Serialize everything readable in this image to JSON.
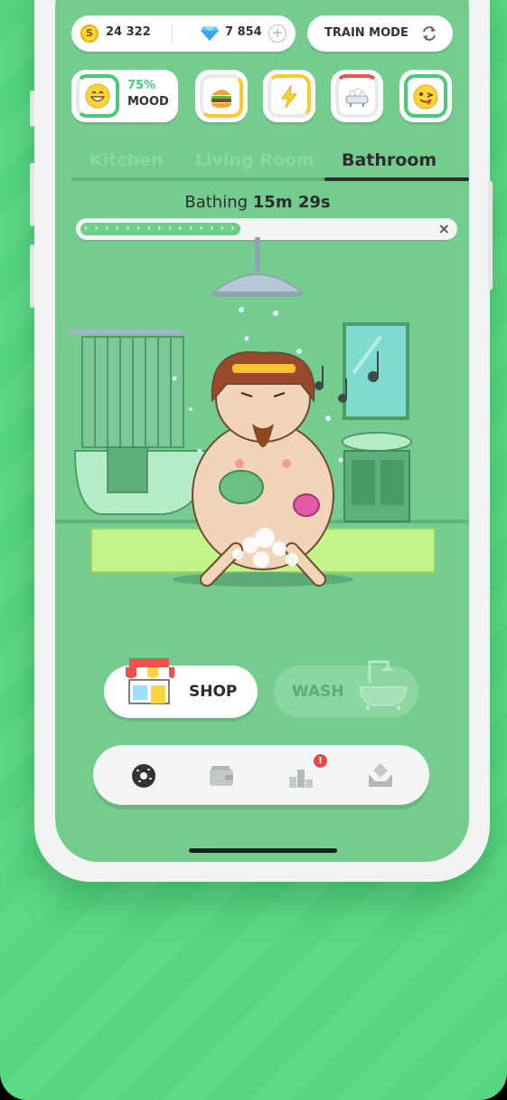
{
  "topbar": {
    "coin_symbol": "S",
    "coins": "24 322",
    "gems": "7 854",
    "add_symbol": "+",
    "train_mode_label": "TRAIN MODE"
  },
  "stats": {
    "mood_percent": "75%",
    "mood_label": "MOOD",
    "items": [
      {
        "icon": "happy-face-icon",
        "level": 0.75,
        "color": "#4cc87a"
      },
      {
        "icon": "burger-icon",
        "level": 0.5,
        "color": "#ffc82c"
      },
      {
        "icon": "lightning-icon",
        "level": 0.35,
        "color": "#ffc82c"
      },
      {
        "icon": "bathtub-icon",
        "level": 0.15,
        "color": "#f2504b"
      },
      {
        "icon": "wink-face-icon",
        "level": 1.0,
        "color": "#4cc87a"
      }
    ]
  },
  "tabs": [
    {
      "label": "Kitchen",
      "active": false
    },
    {
      "label": "Living Room",
      "active": false
    },
    {
      "label": "Bathroom",
      "active": true
    }
  ],
  "activity": {
    "label": "Bathing",
    "time": "15m 29s",
    "progress_arrows": "› › › › › › › › › › › › › › ›",
    "progress": 0.43,
    "close_symbol": "×"
  },
  "actions": {
    "shop_label": "SHOP",
    "wash_label": "WASH"
  },
  "nav": {
    "items": [
      "donut-icon",
      "wallet-icon",
      "leaderboard-icon",
      "trophy-hands-icon"
    ],
    "alert_symbol": "!"
  },
  "colors": {
    "background": "#5cd985",
    "screen": "#75cc8f",
    "accent_green": "#4cc87a",
    "alert_red": "#e84848"
  }
}
